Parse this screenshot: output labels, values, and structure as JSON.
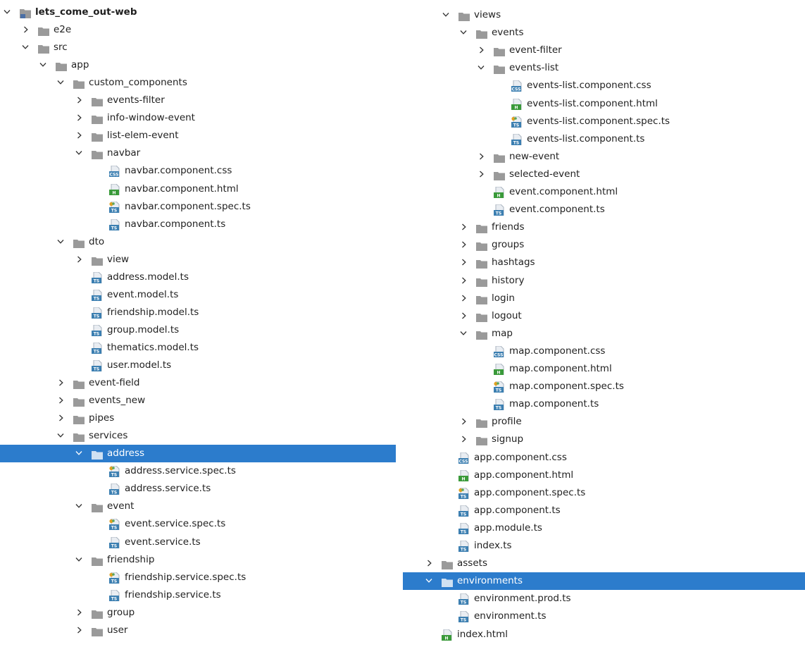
{
  "left_tree": [
    {
      "label": "lets_come_out-web",
      "depth": 0,
      "type": "project",
      "expanded": true
    },
    {
      "label": "e2e",
      "depth": 1,
      "type": "folder",
      "expanded": false
    },
    {
      "label": "src",
      "depth": 1,
      "type": "folder",
      "expanded": true
    },
    {
      "label": "app",
      "depth": 2,
      "type": "folder",
      "expanded": true
    },
    {
      "label": "custom_components",
      "depth": 3,
      "type": "folder",
      "expanded": true
    },
    {
      "label": "events-filter",
      "depth": 4,
      "type": "folder",
      "expanded": false
    },
    {
      "label": "info-window-event",
      "depth": 4,
      "type": "folder",
      "expanded": false
    },
    {
      "label": "list-elem-event",
      "depth": 4,
      "type": "folder",
      "expanded": false
    },
    {
      "label": "navbar",
      "depth": 4,
      "type": "folder",
      "expanded": true
    },
    {
      "label": "navbar.component.css",
      "depth": 5,
      "type": "css"
    },
    {
      "label": "navbar.component.html",
      "depth": 5,
      "type": "html"
    },
    {
      "label": "navbar.component.spec.ts",
      "depth": 5,
      "type": "spec"
    },
    {
      "label": "navbar.component.ts",
      "depth": 5,
      "type": "ts"
    },
    {
      "label": "dto",
      "depth": 3,
      "type": "folder",
      "expanded": true
    },
    {
      "label": "view",
      "depth": 4,
      "type": "folder",
      "expanded": false
    },
    {
      "label": "address.model.ts",
      "depth": 4,
      "type": "ts"
    },
    {
      "label": "event.model.ts",
      "depth": 4,
      "type": "ts"
    },
    {
      "label": "friendship.model.ts",
      "depth": 4,
      "type": "ts"
    },
    {
      "label": "group.model.ts",
      "depth": 4,
      "type": "ts"
    },
    {
      "label": "thematics.model.ts",
      "depth": 4,
      "type": "ts"
    },
    {
      "label": "user.model.ts",
      "depth": 4,
      "type": "ts"
    },
    {
      "label": "event-field",
      "depth": 3,
      "type": "folder",
      "expanded": false
    },
    {
      "label": "events_new",
      "depth": 3,
      "type": "folder",
      "expanded": false
    },
    {
      "label": "pipes",
      "depth": 3,
      "type": "folder",
      "expanded": false
    },
    {
      "label": "services",
      "depth": 3,
      "type": "folder",
      "expanded": true
    },
    {
      "label": "address",
      "depth": 4,
      "type": "folder",
      "expanded": true,
      "selected": true
    },
    {
      "label": "address.service.spec.ts",
      "depth": 5,
      "type": "spec"
    },
    {
      "label": "address.service.ts",
      "depth": 5,
      "type": "ts"
    },
    {
      "label": "event",
      "depth": 4,
      "type": "folder",
      "expanded": true
    },
    {
      "label": "event.service.spec.ts",
      "depth": 5,
      "type": "spec"
    },
    {
      "label": "event.service.ts",
      "depth": 5,
      "type": "ts"
    },
    {
      "label": "friendship",
      "depth": 4,
      "type": "folder",
      "expanded": true
    },
    {
      "label": "friendship.service.spec.ts",
      "depth": 5,
      "type": "spec"
    },
    {
      "label": "friendship.service.ts",
      "depth": 5,
      "type": "ts"
    },
    {
      "label": "group",
      "depth": 4,
      "type": "folder",
      "expanded": false
    },
    {
      "label": "user",
      "depth": 4,
      "type": "folder",
      "expanded": false
    }
  ],
  "right_tree": [
    {
      "label": "views",
      "depth": 3,
      "type": "folder",
      "expanded": true
    },
    {
      "label": "events",
      "depth": 4,
      "type": "folder",
      "expanded": true
    },
    {
      "label": "event-filter",
      "depth": 5,
      "type": "folder",
      "expanded": false
    },
    {
      "label": "events-list",
      "depth": 5,
      "type": "folder",
      "expanded": true
    },
    {
      "label": "events-list.component.css",
      "depth": 6,
      "type": "css"
    },
    {
      "label": "events-list.component.html",
      "depth": 6,
      "type": "html"
    },
    {
      "label": "events-list.component.spec.ts",
      "depth": 6,
      "type": "spec"
    },
    {
      "label": "events-list.component.ts",
      "depth": 6,
      "type": "ts"
    },
    {
      "label": "new-event",
      "depth": 5,
      "type": "folder",
      "expanded": false
    },
    {
      "label": "selected-event",
      "depth": 5,
      "type": "folder",
      "expanded": false
    },
    {
      "label": "event.component.html",
      "depth": 5,
      "type": "html"
    },
    {
      "label": "event.component.ts",
      "depth": 5,
      "type": "ts"
    },
    {
      "label": "friends",
      "depth": 4,
      "type": "folder",
      "expanded": false
    },
    {
      "label": "groups",
      "depth": 4,
      "type": "folder",
      "expanded": false
    },
    {
      "label": "hashtags",
      "depth": 4,
      "type": "folder",
      "expanded": false
    },
    {
      "label": "history",
      "depth": 4,
      "type": "folder",
      "expanded": false
    },
    {
      "label": "login",
      "depth": 4,
      "type": "folder",
      "expanded": false
    },
    {
      "label": "logout",
      "depth": 4,
      "type": "folder",
      "expanded": false
    },
    {
      "label": "map",
      "depth": 4,
      "type": "folder",
      "expanded": true
    },
    {
      "label": "map.component.css",
      "depth": 5,
      "type": "css"
    },
    {
      "label": "map.component.html",
      "depth": 5,
      "type": "html"
    },
    {
      "label": "map.component.spec.ts",
      "depth": 5,
      "type": "spec"
    },
    {
      "label": "map.component.ts",
      "depth": 5,
      "type": "ts"
    },
    {
      "label": "profile",
      "depth": 4,
      "type": "folder",
      "expanded": false
    },
    {
      "label": "signup",
      "depth": 4,
      "type": "folder",
      "expanded": false
    },
    {
      "label": "app.component.css",
      "depth": 3,
      "type": "css"
    },
    {
      "label": "app.component.html",
      "depth": 3,
      "type": "html"
    },
    {
      "label": "app.component.spec.ts",
      "depth": 3,
      "type": "spec"
    },
    {
      "label": "app.component.ts",
      "depth": 3,
      "type": "ts"
    },
    {
      "label": "app.module.ts",
      "depth": 3,
      "type": "ts"
    },
    {
      "label": "index.ts",
      "depth": 3,
      "type": "ts"
    },
    {
      "label": "assets",
      "depth": 2,
      "type": "folder",
      "expanded": false
    },
    {
      "label": "environments",
      "depth": 2,
      "type": "folder",
      "expanded": true,
      "selected": true
    },
    {
      "label": "environment.prod.ts",
      "depth": 3,
      "type": "ts"
    },
    {
      "label": "environment.ts",
      "depth": 3,
      "type": "ts"
    },
    {
      "label": "index.html",
      "depth": 2,
      "type": "html"
    }
  ],
  "icon_labels": {
    "css": "CSS",
    "html": "H",
    "ts": "TS"
  },
  "colors": {
    "selection": "#2c7ccc",
    "folder": "#9a9a9a",
    "file_badge": "#3c7fb1",
    "html_badge": "#3a9a3a",
    "spec_dot": "#e0a020"
  }
}
